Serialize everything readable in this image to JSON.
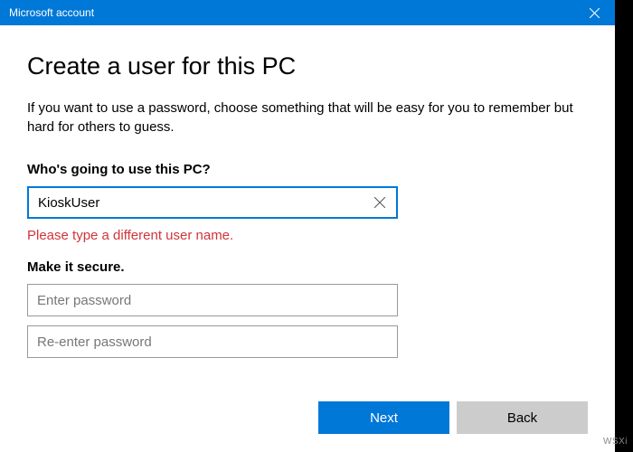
{
  "titlebar": {
    "title": "Microsoft account"
  },
  "heading": "Create a user for this PC",
  "description": "If you want to use a password, choose something that will be easy for you to remember but hard for others to guess.",
  "section_who": {
    "label": "Who's going to use this PC?",
    "username_value": "KioskUser",
    "error": "Please type a different user name."
  },
  "section_secure": {
    "label": "Make it secure.",
    "password_placeholder": "Enter password",
    "password_confirm_placeholder": "Re-enter password"
  },
  "footer": {
    "next_label": "Next",
    "back_label": "Back"
  },
  "watermark": "WSXi",
  "colors": {
    "accent": "#0078d7",
    "error": "#d13438"
  }
}
